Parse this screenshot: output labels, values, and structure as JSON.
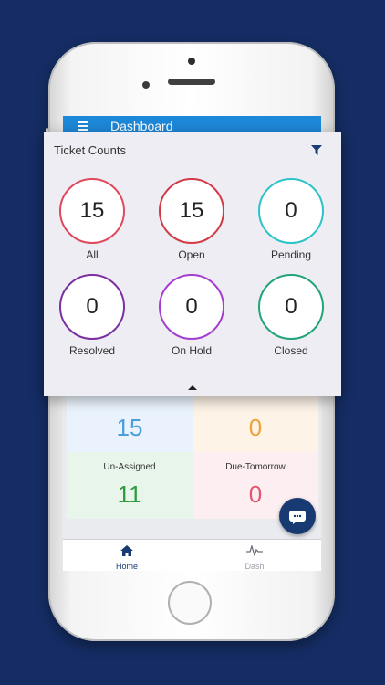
{
  "app": {
    "header_title": "Dashboard"
  },
  "popup": {
    "title": "Ticket Counts",
    "items": [
      {
        "label": "All",
        "value": "15",
        "color": "#e0485c"
      },
      {
        "label": "Open",
        "value": "15",
        "color": "#d23a45"
      },
      {
        "label": "Pending",
        "value": "0",
        "color": "#2bc3c9"
      },
      {
        "label": "Resolved",
        "value": "0",
        "color": "#7b2fa0"
      },
      {
        "label": "On Hold",
        "value": "0",
        "color": "#a53dd1"
      },
      {
        "label": "Closed",
        "value": "0",
        "color": "#21a478"
      }
    ]
  },
  "stats": [
    {
      "label": "",
      "value": "15",
      "bg": "#eaf3fd",
      "color": "#4a9fd8"
    },
    {
      "label": "",
      "value": "0",
      "bg": "#fdf3e7",
      "color": "#f0a03c"
    },
    {
      "label": "Un-Assigned",
      "value": "11",
      "bg": "#e8f5ea",
      "color": "#2e9a3e"
    },
    {
      "label": "Due-Tomorrow",
      "value": "0",
      "bg": "#fdeef1",
      "color": "#e25670"
    }
  ],
  "nav": {
    "home_label": "Home",
    "dash_label": "Dash",
    "active_color": "#173a73",
    "inactive_color": "#9aa0a8"
  }
}
